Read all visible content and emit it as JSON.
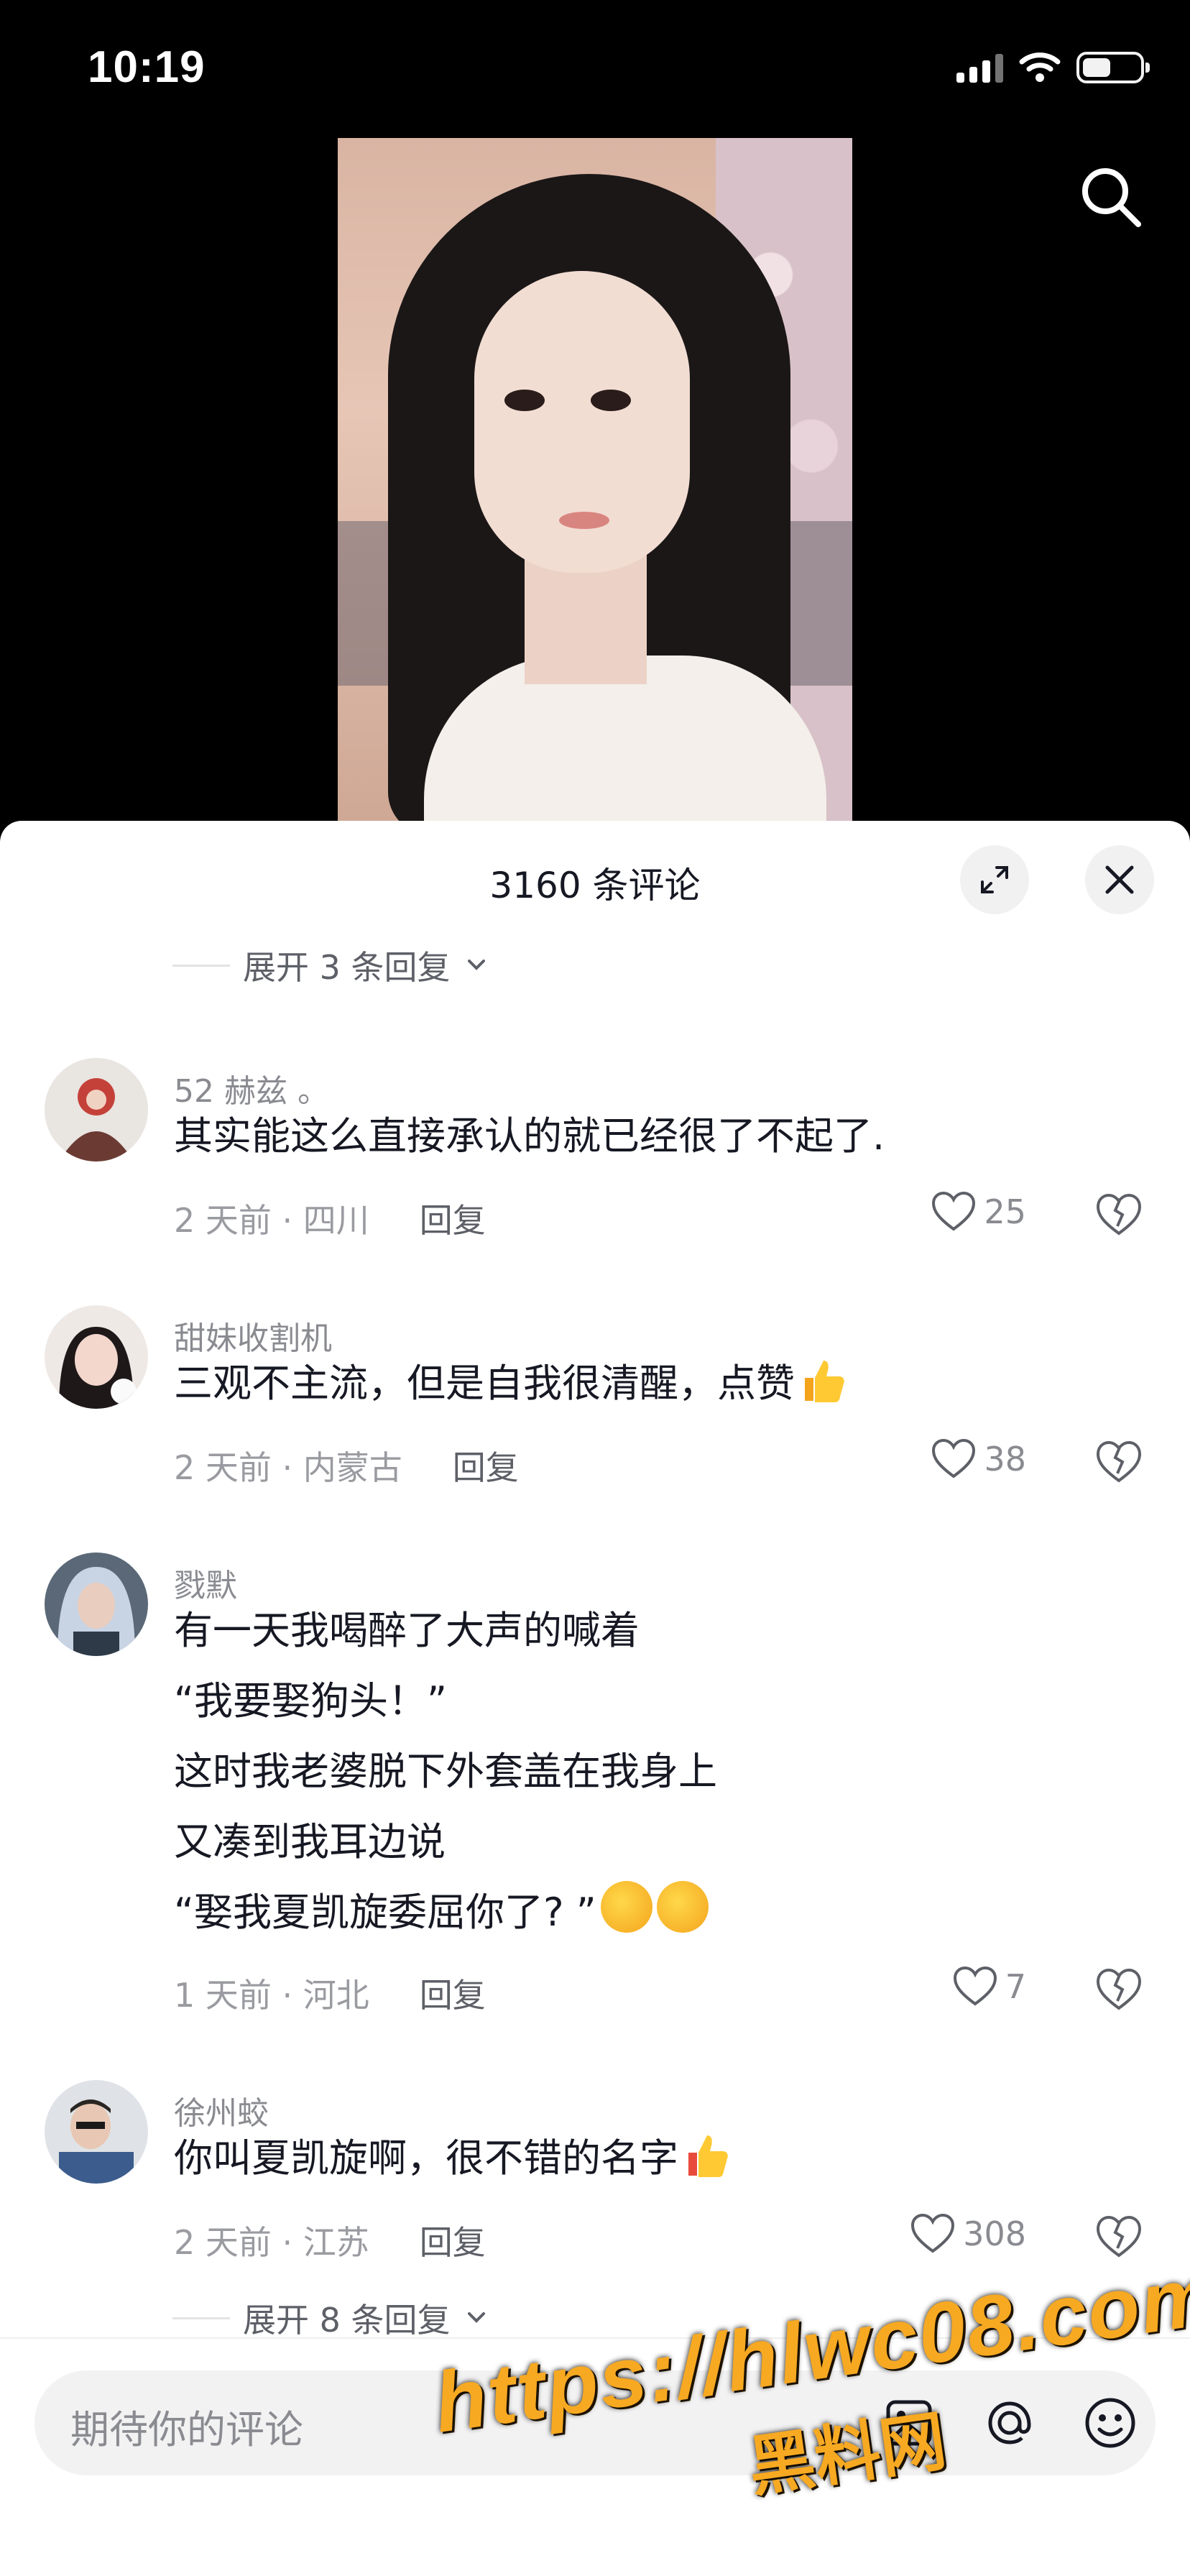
{
  "status_bar": {
    "time": "10:19"
  },
  "comments_panel": {
    "title": "3160 条评论",
    "expand_top": "展开 3 条回复",
    "expand_bottom": "展开 8 条回复",
    "reply_label": "回复",
    "comments": [
      {
        "user": "52 赫兹 。",
        "lines": [
          "其实能这么直接承认的就已经很了不起了."
        ],
        "time_location": "2 天前 · 四川",
        "likes": "25"
      },
      {
        "user": "甜妹收割机",
        "lines": [
          "三观不主流，但是自我很清醒，点赞"
        ],
        "time_location": "2 天前 · 内蒙古",
        "likes": "38"
      },
      {
        "user": "戮默",
        "lines": [
          "有一天我喝醉了大声的喊着",
          "“我要娶狗头！”",
          "这时我老婆脱下外套盖在我身上",
          "又凑到我耳边说",
          "“娶我夏凯旋委屈你了? ”"
        ],
        "time_location": "1 天前 · 河北",
        "likes": "7"
      },
      {
        "user": "徐州蛟",
        "lines": [
          "你叫夏凯旋啊，很不错的名字"
        ],
        "time_location": "2 天前 · 江苏",
        "likes": "308"
      }
    ]
  },
  "bottom_bar": {
    "placeholder": "期待你的评论"
  },
  "watermark": {
    "url": "https://hlwc08.com",
    "name": "黑料网"
  },
  "icons": [
    "search-icon",
    "expand-icon",
    "close-icon",
    "heart-icon",
    "dislike-icon",
    "image-icon",
    "at-icon",
    "emoji-icon",
    "chevron-down-icon"
  ],
  "colors": {
    "accent_watermark": "#f7a922",
    "text": "#161823",
    "secondary": "#8a8b91"
  }
}
